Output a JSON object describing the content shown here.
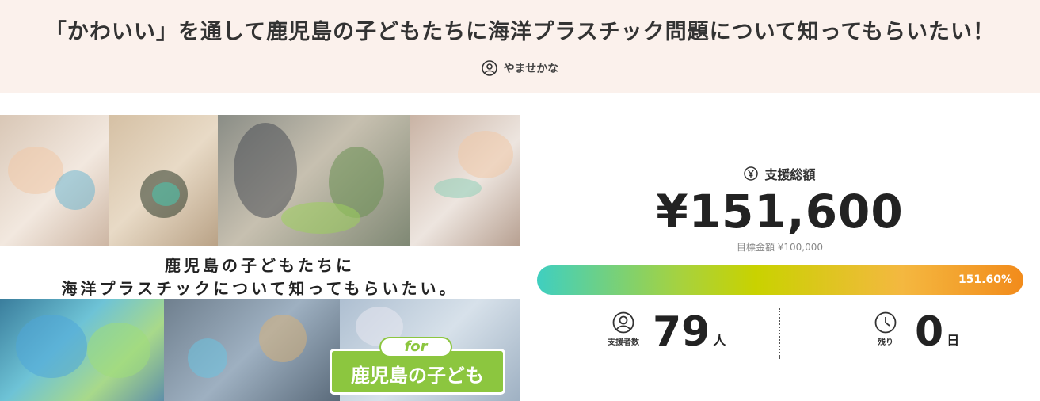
{
  "header": {
    "title": "「かわいい」を通して鹿児島の子どもたちに海洋プラスチック問題について知ってもらいたい！",
    "author": "やませかな",
    "author_icon": "user-circle-icon"
  },
  "hero": {
    "caption_line1": "鹿児島の子どもたちに",
    "caption_line2": "海洋プラスチックについて知ってもらいたい。",
    "badge_for": "for",
    "badge_text": "鹿児島の子ども",
    "badge_color": "#8cc63f"
  },
  "stats": {
    "total_label": "支援総額",
    "total_icon": "yen-circle-icon",
    "total_amount": "¥151,600",
    "goal_text": "目標金額 ¥100,000",
    "progress_text": "151.60%",
    "progress_percent": 151.6,
    "supporters_label": "支援者数",
    "supporters_icon": "user-circle-icon",
    "supporters_count": "79",
    "supporters_unit": "人",
    "remaining_label": "残り",
    "remaining_icon": "clock-icon",
    "remaining_count": "0",
    "remaining_unit": "日"
  }
}
